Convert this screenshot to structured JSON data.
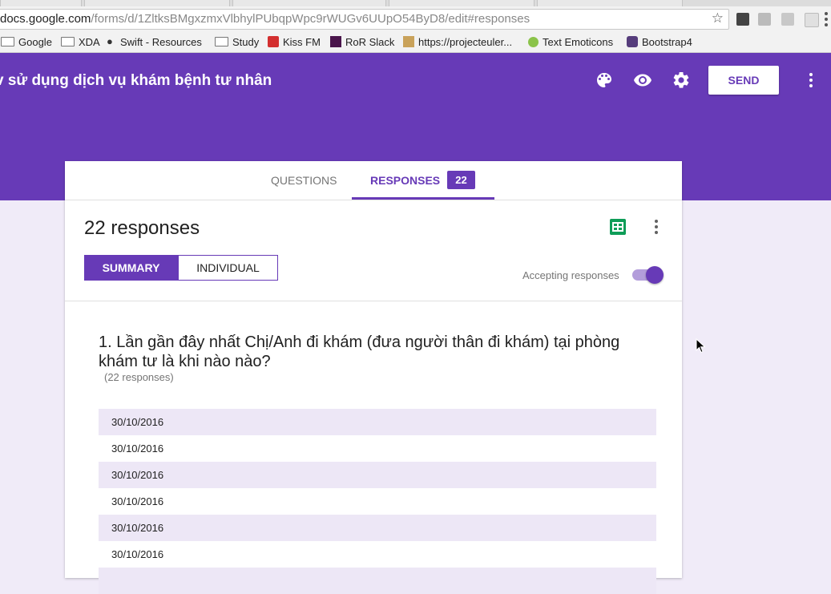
{
  "browser": {
    "url_host": "docs.google.com",
    "url_path": "/forms/d/1ZltksBMgxzmxVlbhylPUbqpWpc9rWUGv6UUpO54ByD8/edit#responses",
    "bookmarks": [
      "Google",
      "XDA",
      "Swift - Resources",
      "Study",
      "Kiss FM",
      "RoR Slack",
      "https://projecteuler...",
      "Text Emoticons",
      "Bootstrap4"
    ]
  },
  "header": {
    "title": "v sử dụng dịch vụ khám bệnh tư nhân",
    "send_label": "SEND",
    "accent": "#673ab7"
  },
  "tabs": {
    "questions": "QUESTIONS",
    "responses": "RESPONSES",
    "responses_count": "22"
  },
  "responses": {
    "count_label": "22 responses",
    "summary_label": "SUMMARY",
    "individual_label": "INDIVIDUAL",
    "accepting_label": "Accepting responses",
    "accepting": true
  },
  "question": {
    "title": "1. Lần gần đây nhất Chị/Anh đi khám (đưa người thân đi khám) tại phòng khám tư là khi nào nào?",
    "count": "(22 responses)",
    "answers": [
      "30/10/2016",
      "30/10/2016",
      "30/10/2016",
      "30/10/2016",
      "30/10/2016",
      "30/10/2016",
      ""
    ]
  }
}
